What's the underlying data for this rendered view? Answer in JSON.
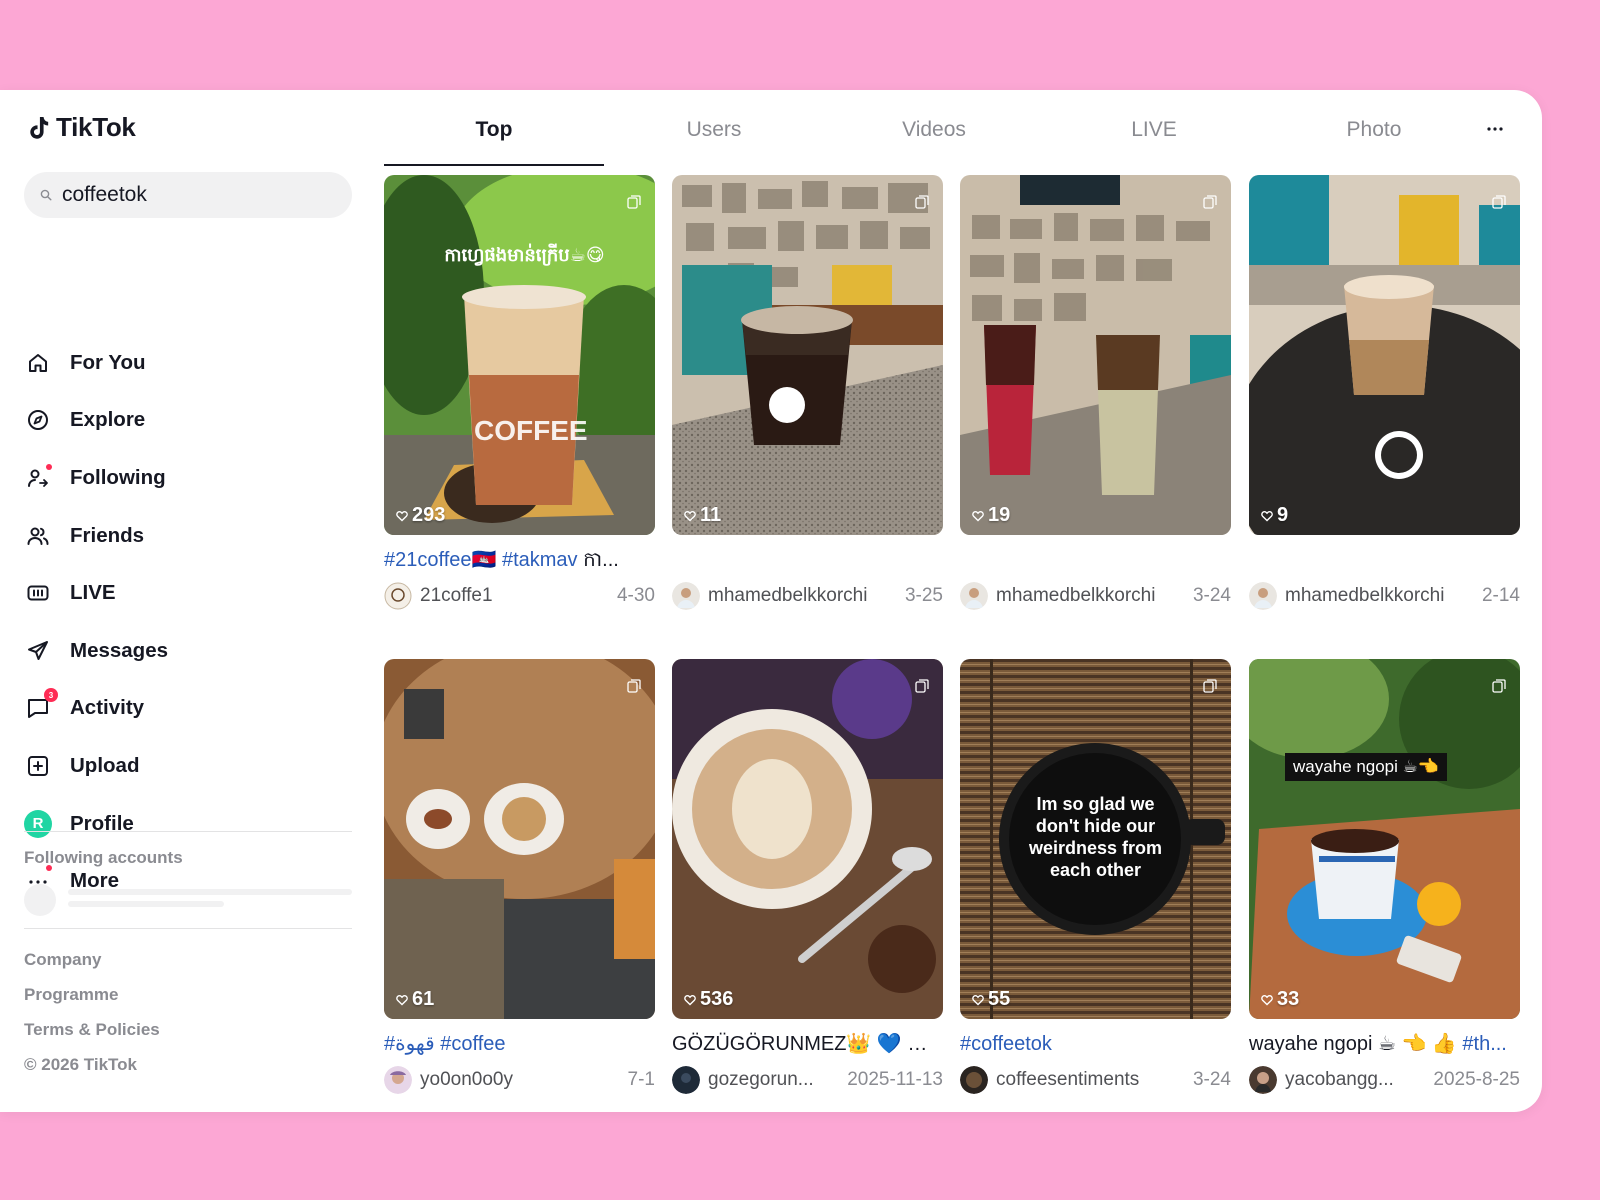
{
  "app": {
    "name": "TikTok"
  },
  "search": {
    "value": "coffeetok",
    "icon": "search-icon"
  },
  "nav": {
    "items": [
      {
        "label": "For You",
        "icon": "home-icon"
      },
      {
        "label": "Explore",
        "icon": "compass-icon"
      },
      {
        "label": "Following",
        "icon": "following-icon"
      },
      {
        "label": "Friends",
        "icon": "friends-icon"
      },
      {
        "label": "LIVE",
        "icon": "live-icon"
      },
      {
        "label": "Messages",
        "icon": "paper-plane-icon"
      },
      {
        "label": "Activity",
        "icon": "chat-bubble-icon",
        "badge": "3"
      },
      {
        "label": "Upload",
        "icon": "plus-square-icon"
      },
      {
        "label": "Profile",
        "icon": "avatar",
        "avatar_letter": "R"
      },
      {
        "label": "More",
        "icon": "more-dots-icon"
      }
    ]
  },
  "following": {
    "title": "Following accounts"
  },
  "footer": {
    "links": [
      "Company",
      "Programme",
      "Terms & Policies"
    ],
    "copyright": "© 2026 TikTok"
  },
  "tabs": [
    "Top",
    "Users",
    "Videos",
    "LIVE",
    "Photo"
  ],
  "active_tab": "Top",
  "colors": {
    "accent": "#fe2c55",
    "hashtag": "#2b5db9",
    "background": "#fca7d4"
  },
  "results": [
    {
      "likes": "293",
      "overlay": "កាហ្វេផងមាន់ក្រើប☕😋",
      "caption_tags": [
        "#21coffee🇰🇭",
        "#takmav"
      ],
      "caption_text": " កា...",
      "author": "21coffe1",
      "date": "4-30"
    },
    {
      "likes": "11",
      "overlay": "",
      "caption_tags": [],
      "caption_text": "",
      "author": "mhamedbelkkorchi",
      "date": "3-25"
    },
    {
      "likes": "19",
      "overlay": "",
      "caption_tags": [],
      "caption_text": "",
      "author": "mhamedbelkkorchi",
      "date": "3-24"
    },
    {
      "likes": "9",
      "overlay": "",
      "caption_tags": [],
      "caption_text": "",
      "author": "mhamedbelkkorchi",
      "date": "2-14"
    },
    {
      "likes": "61",
      "overlay": "",
      "caption_tags": [
        "#قهوة",
        "#coffee"
      ],
      "caption_text": "",
      "author": "yo0on0o0y",
      "date": "7-1"
    },
    {
      "likes": "536",
      "overlay": "",
      "caption_tags": [],
      "caption_text": "GÖZÜGÖRUNMEZ👑 💙 🙏 ...",
      "author": "gozegorun...",
      "date": "2025-11-13"
    },
    {
      "likes": "55",
      "overlay": "Im so glad we don't hide our weirdness from each other",
      "caption_tags": [
        "#coffeetok"
      ],
      "caption_text": "",
      "author": "coffeesentiments",
      "date": "3-24"
    },
    {
      "likes": "33",
      "overlay": "wayahe ngopi ☕👈",
      "caption_tags": [
        "#th..."
      ],
      "caption_text": "wayahe ngopi ☕ 👈 👍 ",
      "caption_text_first": true,
      "author": "yacobangg...",
      "date": "2025-8-25"
    }
  ]
}
